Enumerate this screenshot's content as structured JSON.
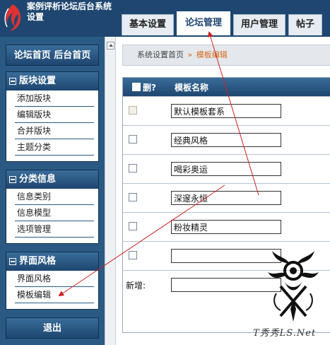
{
  "header": {
    "title": "案例评析论坛后台系统设置",
    "tabs": [
      {
        "label": "基本设置",
        "active": false
      },
      {
        "label": "论坛管理",
        "active": true
      },
      {
        "label": "用户管理",
        "active": false
      },
      {
        "label": "帖子",
        "active": false
      }
    ]
  },
  "sidebar": {
    "home_label": "论坛首页 后台首页",
    "panels": [
      {
        "title": "版块设置",
        "items": [
          "添加版块",
          "编辑版块",
          "合并版块",
          "主题分类"
        ]
      },
      {
        "title": "分类信息",
        "items": [
          "信息类别",
          "信息模型",
          "选项管理"
        ]
      },
      {
        "title": "界面风格",
        "items": [
          "界面风格",
          "模板编辑"
        ]
      }
    ],
    "logout_label": "退出"
  },
  "breadcrumb": {
    "home": "系统设置首页",
    "separator": "»",
    "current": "模板编辑"
  },
  "table": {
    "col_delete": "删?",
    "col_name": "模板名称",
    "rows": [
      {
        "value": "默认模板套系",
        "checkbox_disabled": true
      },
      {
        "value": "经典风格",
        "checkbox_disabled": false
      },
      {
        "value": "喝彩奥运",
        "checkbox_disabled": false
      },
      {
        "value": "深邃永恒",
        "checkbox_disabled": false
      },
      {
        "value": "粉妆精灵",
        "checkbox_disabled": false
      },
      {
        "value": "",
        "checkbox_disabled": false
      }
    ],
    "new_label": "新增:",
    "new_value": ""
  },
  "watermark": "T秀秀LS.Net",
  "colors": {
    "header_bg": "#1e4670",
    "sidebar_bg": "#2a5a84",
    "accent_orange": "#d46a1a",
    "arrow_red": "#cc2222"
  }
}
